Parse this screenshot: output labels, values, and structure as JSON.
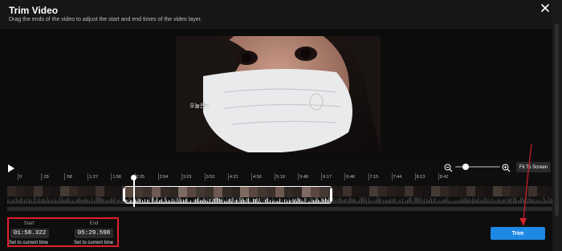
{
  "header": {
    "title": "Trim Video",
    "subtitle": "Drag the ends of the video to adjust the start and end times of the video layer."
  },
  "video": {
    "caption": "오늘은~"
  },
  "controls": {
    "fit_label": "Fit To Screen"
  },
  "ruler": {
    "labels": [
      "0",
      ":29",
      ":58",
      "1:27",
      "1:56",
      "2:25",
      "2:54",
      "3:23",
      "3:52",
      "4:21",
      "4:50",
      "5:19",
      "5:48",
      "6:17",
      "6:46",
      "7:15",
      "7:44",
      "8:13",
      "8:42"
    ]
  },
  "trim": {
    "start_label": "Start",
    "start_value": "01:58.322",
    "end_label": "End",
    "end_value": "05:29.598",
    "set_start_label": "Set to current time",
    "set_end_label": "Set to current time",
    "trim_button": "Trim"
  },
  "colors": {
    "accent": "#1e88e5",
    "highlight": "#e0202a"
  }
}
